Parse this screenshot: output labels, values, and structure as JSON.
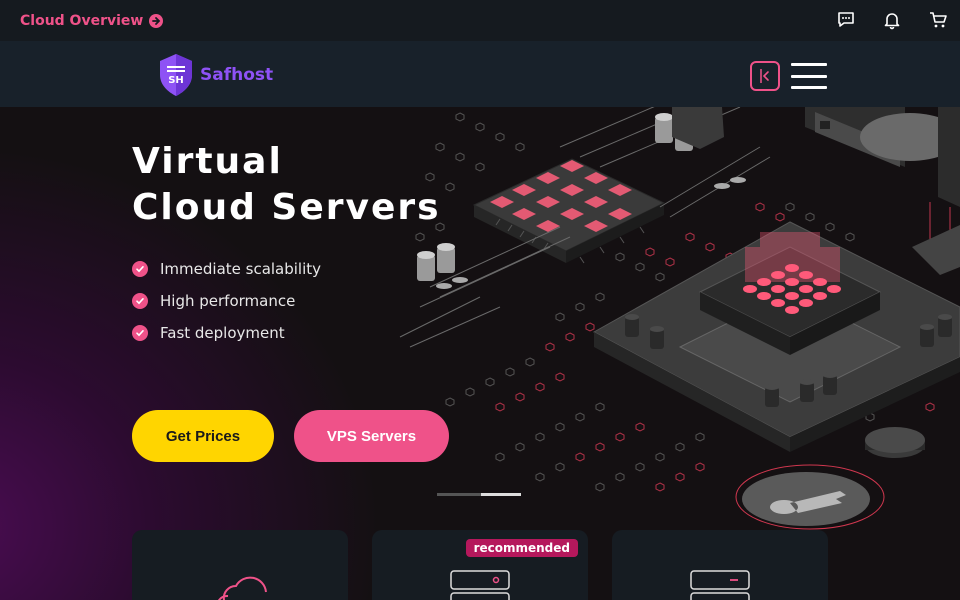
{
  "topbar": {
    "link_label": "Cloud Overview",
    "icons": [
      "chat-icon",
      "bell-icon",
      "cart-icon"
    ]
  },
  "navbar": {
    "logo_text": "Safhost",
    "logo_mark": "SH"
  },
  "hero": {
    "title_line1": "Virtual",
    "title_line2": "Cloud Servers",
    "features": [
      "Immediate scalability",
      "High performance",
      "Fast deployment"
    ],
    "buttons": {
      "primary": "Get Prices",
      "secondary": "VPS Servers"
    }
  },
  "cards": [
    {
      "icon": "cloud-icon",
      "badge": ""
    },
    {
      "icon": "server-icon",
      "badge": "recommended"
    },
    {
      "icon": "server-icon",
      "badge": ""
    }
  ],
  "colors": {
    "accent_pink": "#ef5289",
    "accent_yellow": "#ffd500",
    "brand_purple": "#8e52f5",
    "badge_bg": "#b5185c"
  }
}
